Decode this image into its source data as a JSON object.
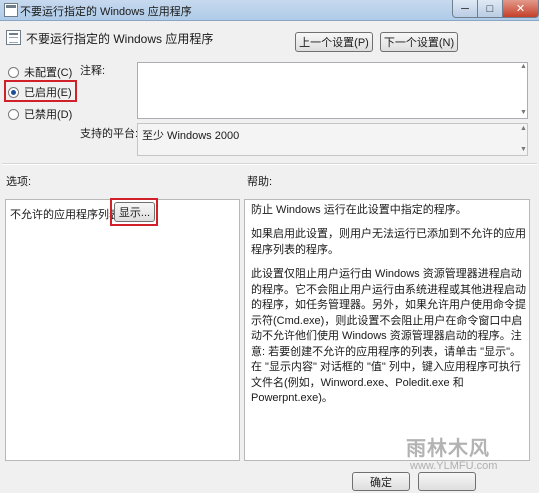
{
  "window": {
    "title": "不要运行指定的 Windows 应用程序",
    "minimize": "─",
    "maximize": "□",
    "close": "✕"
  },
  "header": {
    "policy_title": "不要运行指定的 Windows 应用程序",
    "prev_button": "上一个设置(P)",
    "next_button": "下一个设置(N)"
  },
  "state": {
    "options": [
      {
        "label": "未配置(C)",
        "checked": false
      },
      {
        "label": "已启用(E)",
        "checked": true
      },
      {
        "label": "已禁用(D)",
        "checked": false
      }
    ]
  },
  "comment": {
    "label": "注释:",
    "value": ""
  },
  "platform": {
    "label": "支持的平台:",
    "value": "至少 Windows 2000"
  },
  "sections": {
    "options_label": "选项:",
    "help_label": "帮助:"
  },
  "options_panel": {
    "disallowed_label": "不允许的应用程序列表",
    "show_button": "显示..."
  },
  "help": {
    "p1": "防止 Windows 运行在此设置中指定的程序。",
    "p2": "如果启用此设置，则用户无法运行已添加到不允许的应用程序列表的程序。",
    "p3": "此设置仅阻止用户运行由 Windows 资源管理器进程启动的程序。它不会阻止用户运行由系统进程或其他进程启动的程序，如任务管理器。另外，如果允许用户使用命令提示符(Cmd.exe)，则此设置不会阻止用户在命令窗口中启动不允许他们使用 Windows 资源管理器启动的程序。注意: 若要创建不允许的应用程序的列表，请单击 \"显示\"。在 \"显示内容\" 对话框的 \"值\" 列中，键入应用程序可执行文件名(例如，Winword.exe、Poledit.exe 和 Powerpnt.exe)。"
  },
  "footer": {
    "ok_button": "确定"
  },
  "watermark": {
    "top": "雨林木风",
    "bottom": "www.YLMFU.com"
  },
  "colors": {
    "highlight": "#d0202a",
    "accent": "#1b4f9c"
  }
}
